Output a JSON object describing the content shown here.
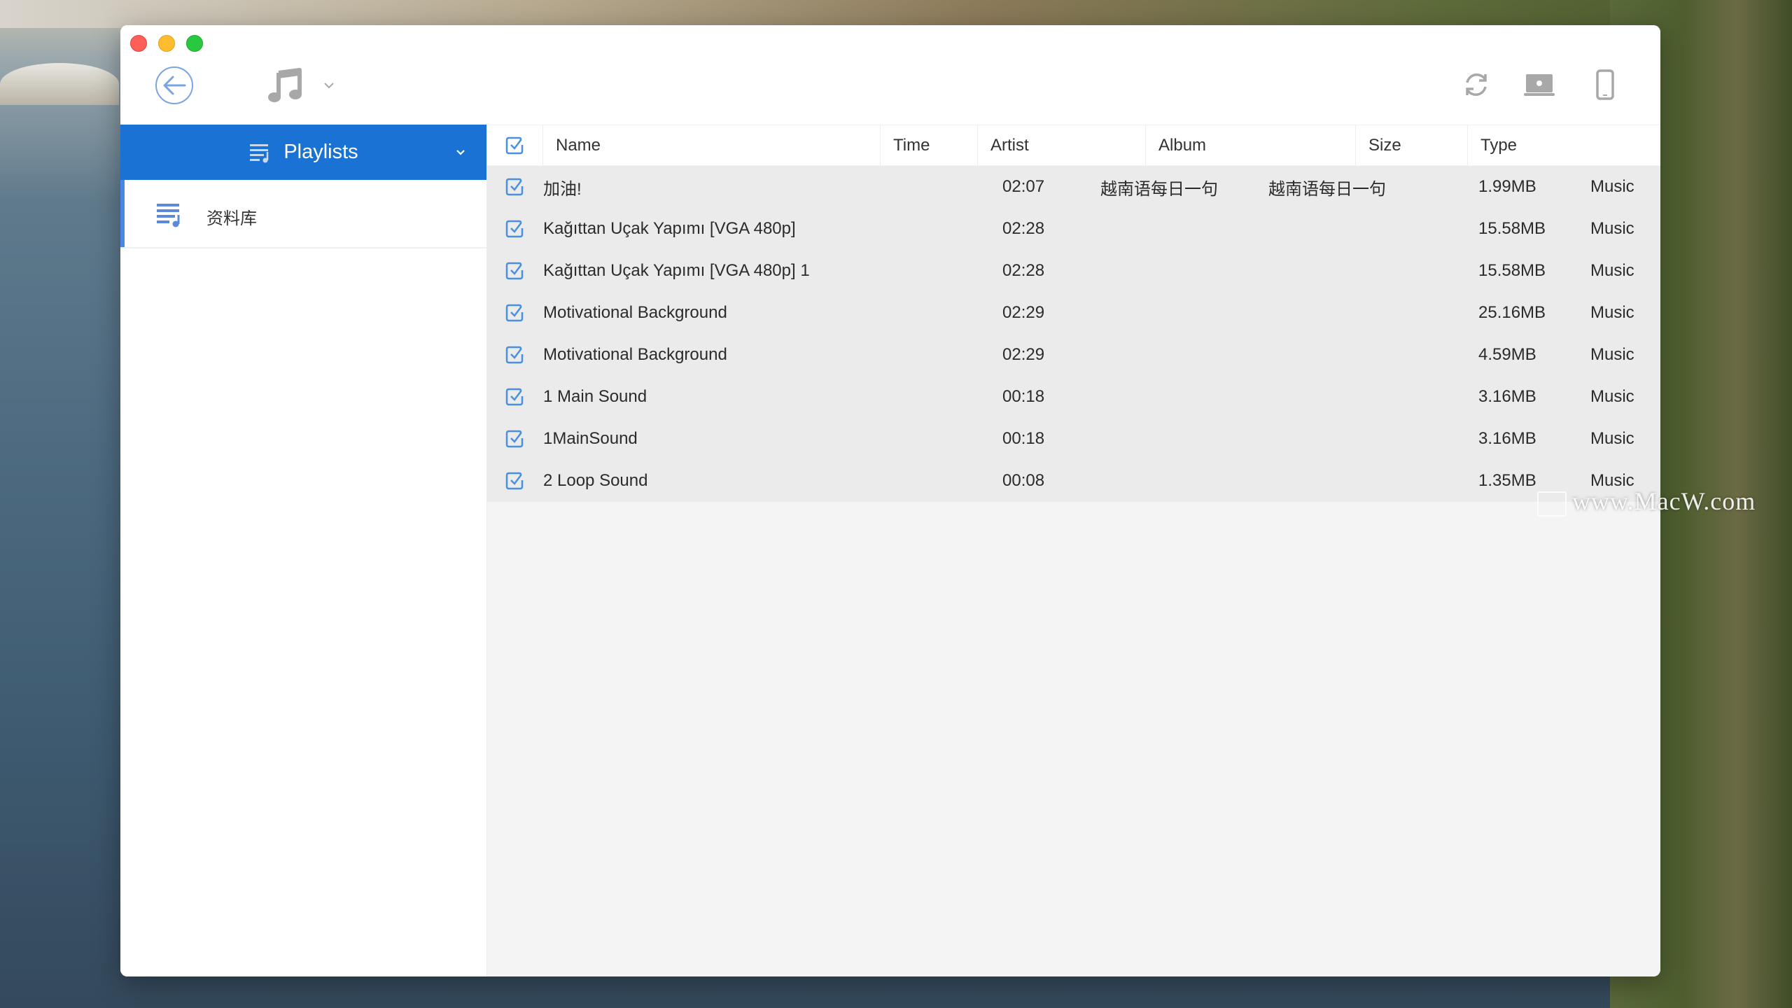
{
  "window": {
    "traffic_lights": [
      "close",
      "minimize",
      "maximize"
    ]
  },
  "toolbar": {
    "back_icon": "arrow-left-circle-icon",
    "media_type_icon": "music-note-icon",
    "media_type_dropdown_icon": "chevron-down-icon",
    "right_icons": [
      "sync-icon",
      "mac-computer-icon",
      "iphone-icon"
    ]
  },
  "sidebar": {
    "header_label": "Playlists",
    "header_icon": "playlist-icon",
    "items": [
      {
        "label": "资料库",
        "icon": "playlist-icon",
        "selected": true
      }
    ]
  },
  "table": {
    "columns": [
      "Name",
      "Time",
      "Artist",
      "Album",
      "Size",
      "Type"
    ],
    "select_all_checked": true,
    "rows": [
      {
        "checked": true,
        "name": "加油!",
        "time": "02:07",
        "artist": "越南语每日一句",
        "album": "越南语每日一句",
        "size": "1.99MB",
        "type": "Music"
      },
      {
        "checked": true,
        "name": "Kağıttan Uçak Yapımı [VGA 480p]",
        "time": "02:28",
        "artist": "",
        "album": "",
        "size": "15.58MB",
        "type": "Music"
      },
      {
        "checked": true,
        "name": "Kağıttan Uçak Yapımı [VGA 480p] 1",
        "time": "02:28",
        "artist": "",
        "album": "",
        "size": "15.58MB",
        "type": "Music"
      },
      {
        "checked": true,
        "name": "Motivational Background",
        "time": "02:29",
        "artist": "",
        "album": "",
        "size": "25.16MB",
        "type": "Music"
      },
      {
        "checked": true,
        "name": "Motivational Background",
        "time": "02:29",
        "artist": "",
        "album": "",
        "size": "4.59MB",
        "type": "Music"
      },
      {
        "checked": true,
        "name": "1 Main Sound",
        "time": "00:18",
        "artist": "",
        "album": "",
        "size": "3.16MB",
        "type": "Music"
      },
      {
        "checked": true,
        "name": "1MainSound",
        "time": "00:18",
        "artist": "",
        "album": "",
        "size": "3.16MB",
        "type": "Music"
      },
      {
        "checked": true,
        "name": "2 Loop Sound",
        "time": "00:08",
        "artist": "",
        "album": "",
        "size": "1.35MB",
        "type": "Music"
      }
    ]
  },
  "watermark": "www.MacW.com",
  "colors": {
    "accent": "#1a73d4",
    "checkbox": "#4a90e2",
    "row_bg": "#ebebeb",
    "icon_gray": "#a8a8a8"
  }
}
